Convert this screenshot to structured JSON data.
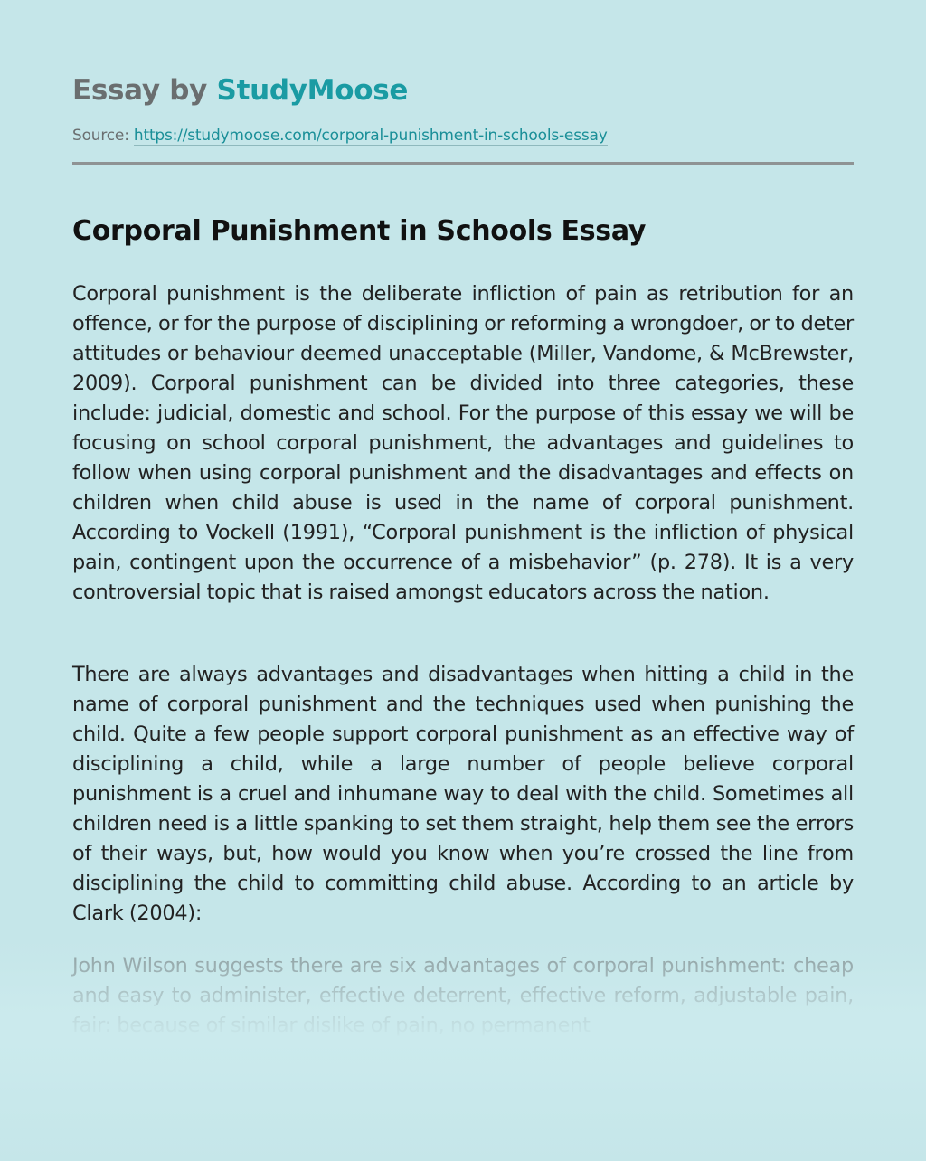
{
  "header": {
    "brand_prefix": "Essay by ",
    "brand_name": "StudyMoose",
    "source_label": "Source: ",
    "source_url": "https://studymoose.com/corporal-punishment-in-schools-essay"
  },
  "article": {
    "title": "Corporal Punishment in Schools Essay",
    "paragraphs": [
      "Corporal punishment is the deliberate infliction of pain as retribution for an offence, or for the purpose of disciplining or reforming a wrongdoer, or to deter attitudes or behaviour deemed unacceptable (Miller, Vandome, & McBrewster, 2009). Corporal punishment can be divided into three categories, these include: judicial, domestic and school. For the purpose of this essay we will be focusing on school corporal punishment, the advantages and guidelines to follow when using corporal punishment and the disadvantages and effects on children when child abuse is used in the name of corporal punishment. According to Vockell (1991), “Corporal punishment is the infliction of physical pain, contingent upon the occurrence of a misbehavior” (p. 278). It is a very controversial topic that is raised amongst educators across the nation.",
      "There are always advantages and disadvantages when hitting a child in the name of corporal punishment and the techniques used when punishing the child. Quite a few people support corporal punishment as an effective way of disciplining a child, while a large number of people believe corporal punishment is a cruel and inhumane way to deal with the child. Sometimes all children need is a little spanking to set them straight, help them see the errors of their ways, but, how would you know when you’re crossed the line from disciplining the child to committing child abuse. According to an article by Clark (2004):",
      "John Wilson suggests there are six advantages of corporal punishment: cheap and easy to administer, effective deterrent, effective reform, adjustable pain, fair: because of similar dislike of pain, no permanent"
    ]
  },
  "colors": {
    "background": "#c5e6e9",
    "brand_accent": "#1a9ba3",
    "muted_text": "#6a6e6f",
    "body_text": "#222222",
    "divider": "#8f9394"
  }
}
